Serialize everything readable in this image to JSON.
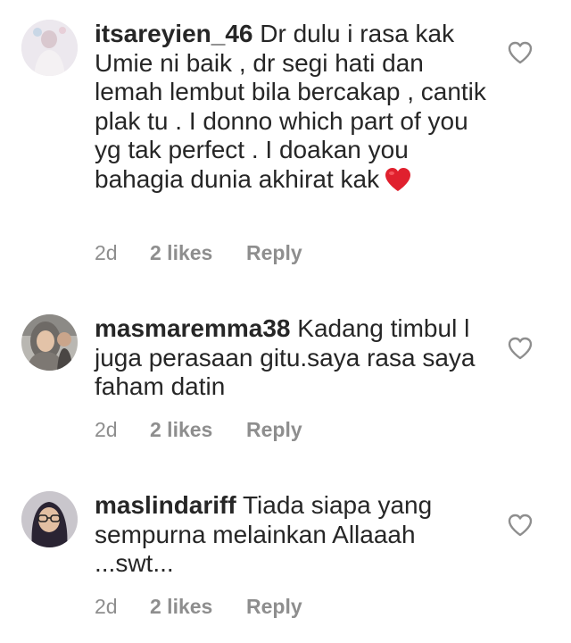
{
  "comments": [
    {
      "username": "itsareyien_46",
      "text": "Dr dulu i rasa kak Umie ni baik , dr segi hati dan lemah lembut bila bercakap , cantik plak tu . I donno which part of you yg tak perfect . I doakan you bahagia dunia akhirat kak",
      "emoji": "red-heart-emoji",
      "time": "2d",
      "likes": "2 likes",
      "reply": "Reply",
      "like_icon": "heart-outline-icon"
    },
    {
      "username": "masmaremma38",
      "text": "Kadang timbul l juga perasaan gitu.saya rasa saya faham datin",
      "time": "2d",
      "likes": "2 likes",
      "reply": "Reply",
      "like_icon": "heart-outline-icon"
    },
    {
      "username": "maslindariff",
      "text": "Tiada siapa yang sempurna melainkan Allaaah ...swt...",
      "time": "2d",
      "likes": "2 likes",
      "reply": "Reply",
      "like_icon": "heart-outline-icon"
    }
  ],
  "colors": {
    "text": "#262626",
    "meta": "#8e8e8e",
    "heart_emoji": "#e0202e"
  }
}
